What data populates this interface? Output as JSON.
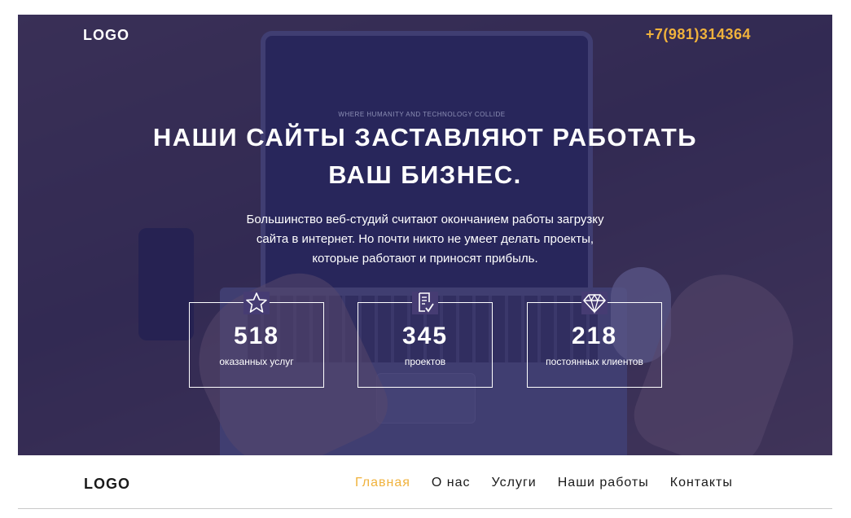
{
  "header": {
    "logo": "LOGO",
    "phone": "+7(981)314364"
  },
  "hero": {
    "headline_line1": "НАШИ САЙТЫ ЗАСТАВЛЯЮТ РАБОТАТЬ",
    "headline_line2": "ВАШ БИЗНЕС.",
    "subtext_line1": "Большинство веб-студий считают окончанием работы загрузку",
    "subtext_line2": "сайта в интернет. Но почти никто не умеет делать проекты,",
    "subtext_line3": "которые работают и приносят прибыль.",
    "screen_text": "WHERE HUMANITY AND TECHNOLOGY COLLIDE"
  },
  "stats": [
    {
      "value": "518",
      "label": "оказанных услуг",
      "icon": "star-icon"
    },
    {
      "value": "345",
      "label": "проектов",
      "icon": "document-check-icon"
    },
    {
      "value": "218",
      "label": "постоянных клиентов",
      "icon": "diamond-icon"
    }
  ],
  "nav": {
    "logo": "LOGO",
    "items": [
      {
        "label": "Главная",
        "active": true
      },
      {
        "label": "О нас",
        "active": false
      },
      {
        "label": "Услуги",
        "active": false
      },
      {
        "label": "Наши работы",
        "active": false
      },
      {
        "label": "Контакты",
        "active": false
      }
    ]
  },
  "colors": {
    "accent": "#f0b23c",
    "overlay": "#2e2968",
    "text_dark": "#1a1a1a"
  }
}
